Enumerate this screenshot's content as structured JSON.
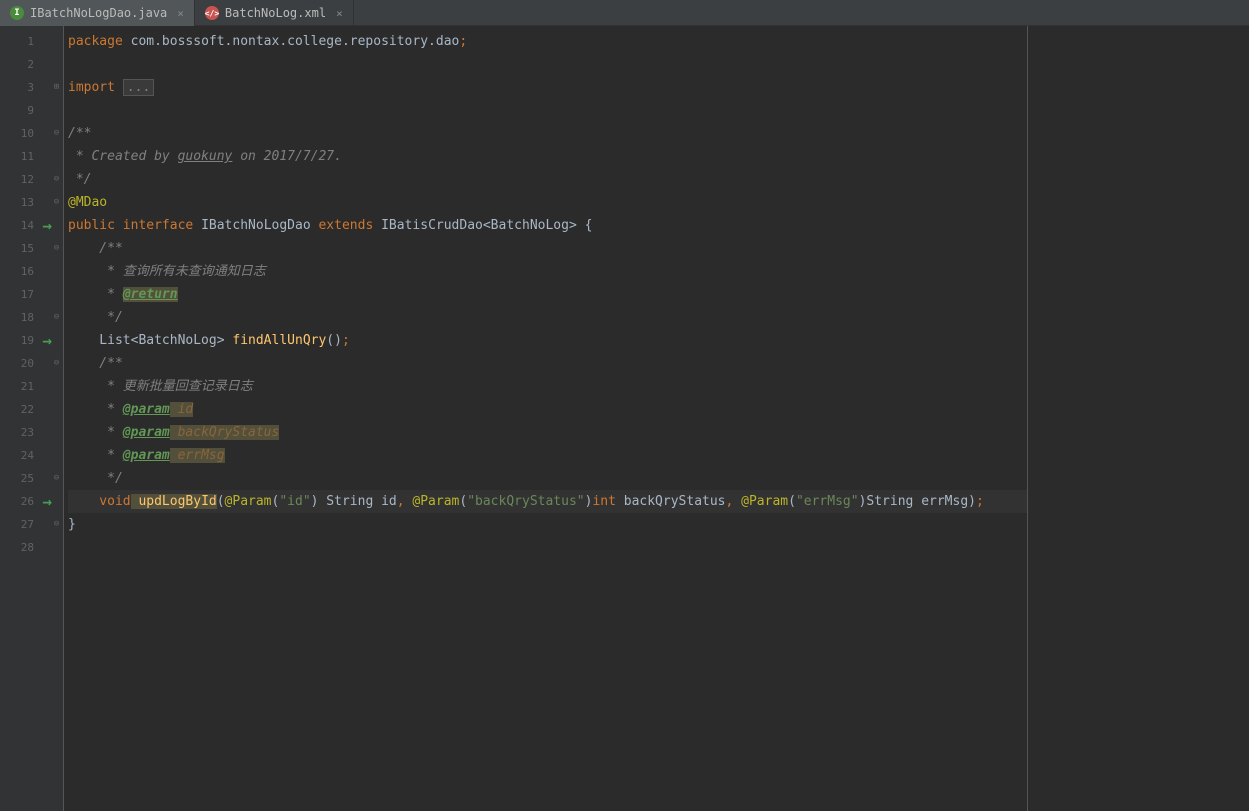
{
  "tabs": [
    {
      "label": "IBatchNoLogDao.java",
      "type": "java",
      "icon_letter": "I",
      "active": true
    },
    {
      "label": "BatchNoLog.xml",
      "type": "xml",
      "icon_letter": "",
      "active": false
    }
  ],
  "line_numbers": [
    1,
    2,
    3,
    9,
    10,
    11,
    12,
    13,
    14,
    15,
    16,
    17,
    18,
    19,
    20,
    21,
    22,
    23,
    24,
    25,
    26,
    27,
    28
  ],
  "arrow_lines": [
    14,
    19,
    26
  ],
  "fold_marks": {
    "3": "⊞",
    "10": "⊖",
    "12": "⊖",
    "13": "⊖",
    "15": "⊖",
    "18": "⊖",
    "20": "⊖",
    "25": "⊖",
    "27": "⊖"
  },
  "code": {
    "l1": {
      "kw": "package",
      "pkg": " com.bosssoft.nontax.college.repository.dao",
      "semi": ";"
    },
    "l3": {
      "kw": "import",
      "fold": "..."
    },
    "l10": "/**",
    "l11a": " * Created by ",
    "l11b": "guokuny",
    "l11c": " on 2017/7/27.",
    "l12": " */",
    "l13": "@MDao",
    "l14a": "public",
    "l14b": " interface",
    "l14c": " IBatchNoLogDao ",
    "l14d": "extends",
    "l14e": " IBatisCrudDao<BatchNoLog> {",
    "l15": "    /**",
    "l16": "     * 查询所有未查询通知日志",
    "l17a": "     * ",
    "l17b": "@return",
    "l18": "     */",
    "l19a": "    List<BatchNoLog> ",
    "l19b": "findAllUnQry",
    "l19c": "()",
    "l19d": ";",
    "l20": "    /**",
    "l21": "     * 更新批量回查记录日志",
    "l22a": "     * ",
    "l22b": "@param",
    "l22c": " id",
    "l23a": "     * ",
    "l23b": "@param",
    "l23c": " backQryStatus",
    "l24a": "     * ",
    "l24b": "@param",
    "l24c": " errMsg",
    "l25": "     */",
    "l26a": "    void",
    "l26b": " updLogById",
    "l26c": "(",
    "l26d": "@Param",
    "l26e": "(",
    "l26f": "\"id\"",
    "l26g": ") String id",
    "l26h": ",",
    "l26i": " @Param",
    "l26j": "(",
    "l26k": "\"backQryStatus\"",
    "l26l": ")",
    "l26m": "int",
    "l26n": " backQryStatus",
    "l26o": ",",
    "l26p": " @Param",
    "l26q": "(",
    "l26r": "\"errMsg\"",
    "l26s": ")String errMsg)",
    "l26t": ";",
    "l27": "}"
  }
}
